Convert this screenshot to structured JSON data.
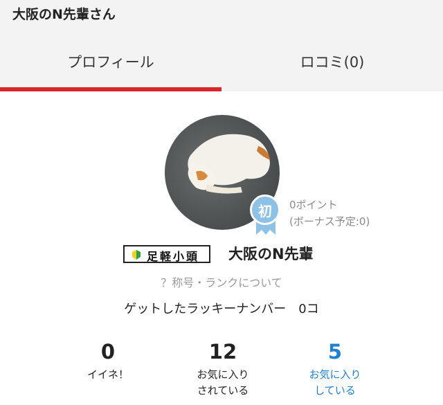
{
  "header": {
    "title": "大阪のN先輩さん",
    "tabs": [
      {
        "label": "プロフィール",
        "active": true
      },
      {
        "label": "ロコミ(0)",
        "active": false
      }
    ],
    "accent_color": "#d7262c"
  },
  "profile": {
    "beginner_badge": "初",
    "points": "0ポイント",
    "bonus_points": "(ボーナス予定:0)",
    "rank_badge": "足軽小頭",
    "name": "大阪のN先輩",
    "title_link": "？称号・ランクについて",
    "lucky_number": "ゲットしたラッキーナンバー　0コ"
  },
  "stats": [
    {
      "value": "0",
      "label_line1": "イイネ！",
      "label_line2": ""
    },
    {
      "value": "12",
      "label_line1": "お気に入り",
      "label_line2": "されている"
    },
    {
      "value": "5",
      "label_line1": "お気に入り",
      "label_line2": "している"
    }
  ],
  "colors": {
    "link_blue": "#1f7fd0",
    "muted_gray": "#9a9a9a",
    "badge_blue": "#8ec1e6"
  }
}
